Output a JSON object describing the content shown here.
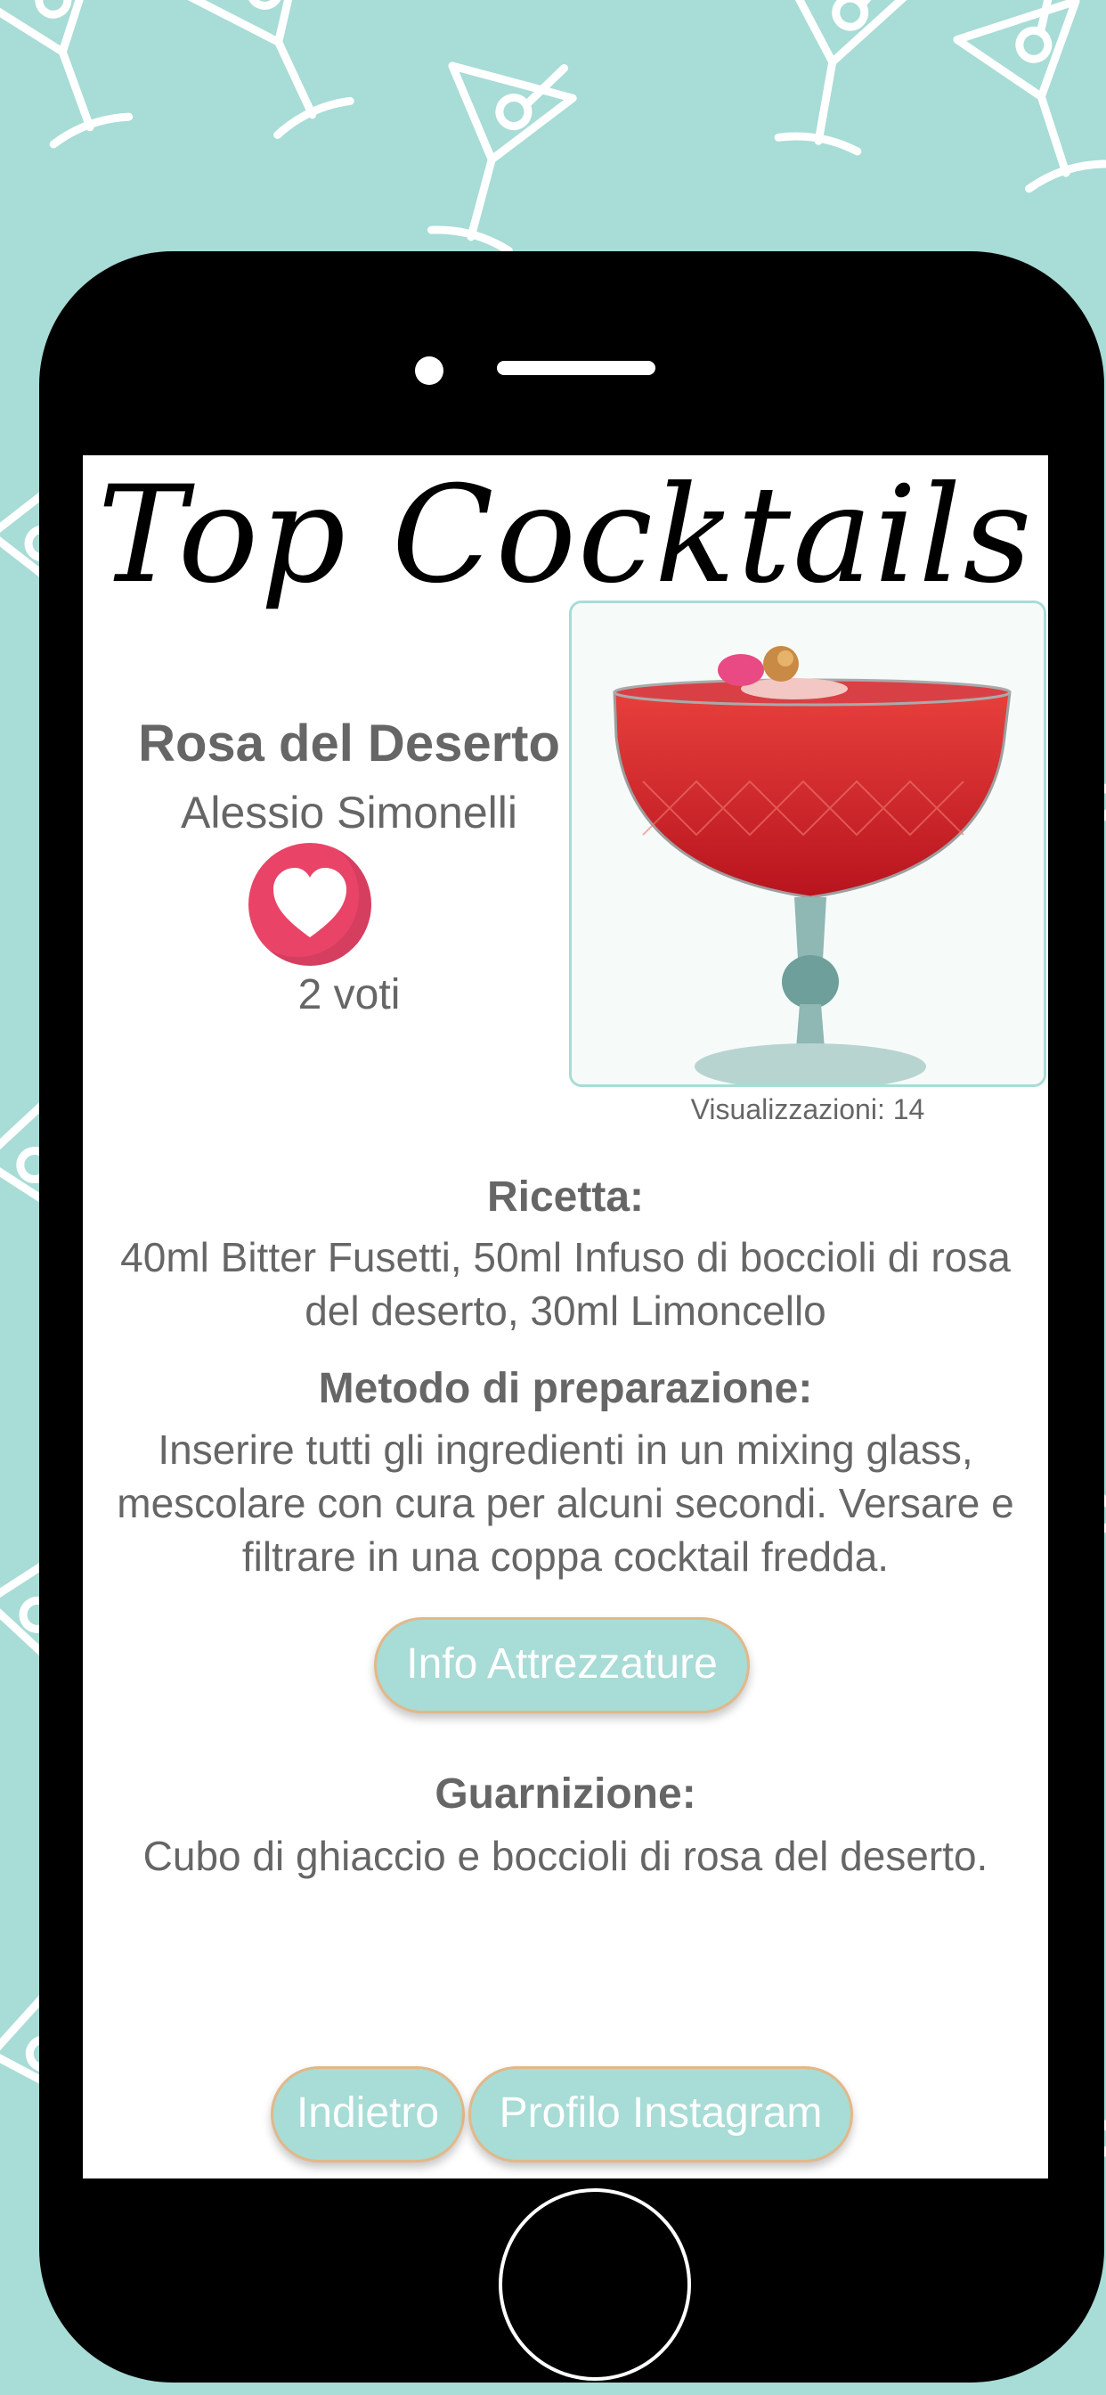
{
  "app": {
    "title": "Top Cocktails"
  },
  "drink": {
    "name": "Rosa del Deserto",
    "author": "Alessio Simonelli",
    "votes": "2 voti",
    "views": "Visualizzazioni: 14"
  },
  "recipe": {
    "title": "Ricetta:",
    "text": "40ml Bitter Fusetti, 50ml Infuso di boccioli di rosa del deserto, 30ml Limoncello"
  },
  "method": {
    "title": "Metodo di preparazione:",
    "text": "Inserire tutti gli ingredienti in un mixing glass, mescolare con cura per alcuni secondi. Versare e filtrare in una coppa cocktail fredda."
  },
  "buttons": {
    "equipment": "Info Attrezzature",
    "back": "Indietro",
    "instagram": "Profilo Instagram"
  },
  "garnish": {
    "title": "Guarnizione:",
    "text": "Cubo di ghiaccio e boccioli di rosa del deserto."
  },
  "icons": {
    "like": "heart-icon",
    "photo": "cocktail-glass-photo",
    "background": "martini-glass-pattern"
  },
  "colors": {
    "background": "#a8dcd6",
    "accent": "#e94468",
    "button_border": "#e2b889",
    "text": "#666666"
  }
}
